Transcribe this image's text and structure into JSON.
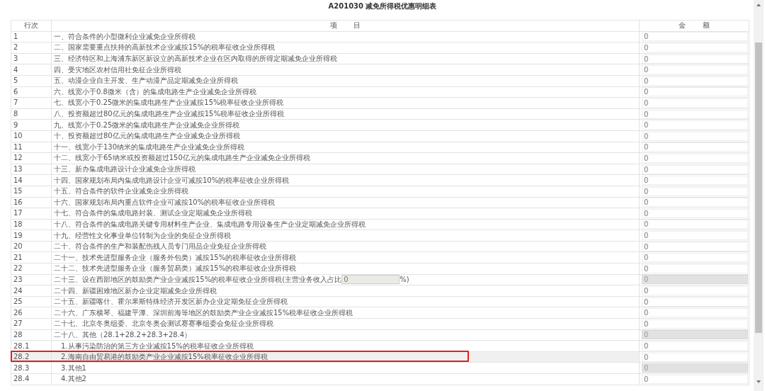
{
  "title": "A201030 减免所得税优惠明细表",
  "columns": [
    "行次",
    "项 目",
    "金 额"
  ],
  "rows": [
    {
      "line": "1",
      "item": "一、符合条件的小型微利企业减免企业所得税",
      "amount": "0",
      "disabled": false,
      "highlighted": false
    },
    {
      "line": "2",
      "item": "二、国家需要重点扶持的高新技术企业减按15%的税率征收企业所得税",
      "amount": "0",
      "disabled": false,
      "highlighted": false
    },
    {
      "line": "3",
      "item": "三、经济特区和上海浦东新区新设立的高新技术企业在区内取得的所得定期减免企业所得税",
      "amount": "0",
      "disabled": false,
      "highlighted": false
    },
    {
      "line": "4",
      "item": "四、受灾地区农村信用社免征企业所得税",
      "amount": "0",
      "disabled": false,
      "highlighted": false
    },
    {
      "line": "5",
      "item": "五、动漫企业自主开发、生产动漫产品定期减免企业所得税",
      "amount": "0",
      "disabled": false,
      "highlighted": false
    },
    {
      "line": "6",
      "item": "六、线宽小于0.8微米（含）的集成电路生产企业减免企业所得税",
      "amount": "0",
      "disabled": false,
      "highlighted": false
    },
    {
      "line": "7",
      "item": "七、线宽小于0.25微米的集成电路生产企业减按15%税率征收企业所得税",
      "amount": "0",
      "disabled": false,
      "highlighted": false
    },
    {
      "line": "8",
      "item": "八、投资额超过80亿元的集成电路生产企业减按15%税率征收企业所得税",
      "amount": "0",
      "disabled": false,
      "highlighted": false
    },
    {
      "line": "9",
      "item": "九、线宽小于0.25微米的集成电路生产企业减免企业所得税",
      "amount": "0",
      "disabled": false,
      "highlighted": false
    },
    {
      "line": "10",
      "item": "十、投资额超过80亿元的集成电路生产企业减免企业所得税",
      "amount": "0",
      "disabled": false,
      "highlighted": false
    },
    {
      "line": "11",
      "item": "十一、线宽小于130纳米的集成电路生产企业减免企业所得税",
      "amount": "0",
      "disabled": false,
      "highlighted": false
    },
    {
      "line": "12",
      "item": "十二、线宽小于65纳米或投资额超过150亿元的集成电路生产企业减免企业所得税",
      "amount": "0",
      "disabled": false,
      "highlighted": false
    },
    {
      "line": "13",
      "item": "十三、新办集成电路设计企业减免企业所得税",
      "amount": "0",
      "disabled": false,
      "highlighted": false
    },
    {
      "line": "14",
      "item": "十四、国家规划布局内集成电路设计企业可减按10%的税率征收企业所得税",
      "amount": "0",
      "disabled": false,
      "highlighted": false
    },
    {
      "line": "15",
      "item": "十五、符合条件的软件企业减免企业所得税",
      "amount": "0",
      "disabled": false,
      "highlighted": false
    },
    {
      "line": "16",
      "item": "十六、国家规划布局内重点软件企业可减按10%的税率征收企业所得税",
      "amount": "0",
      "disabled": false,
      "highlighted": false
    },
    {
      "line": "17",
      "item": "十七、符合条件的集成电路封装、测试企业定期减免企业所得税",
      "amount": "0",
      "disabled": false,
      "highlighted": false
    },
    {
      "line": "18",
      "item": "十八、符合条件的集成电路关键专用材料生产企业、集成电路专用设备生产企业定期减免企业所得税",
      "amount": "0",
      "disabled": false,
      "highlighted": false
    },
    {
      "line": "19",
      "item": "十九、经营性文化事业单位转制为企业的免征企业所得税",
      "amount": "0",
      "disabled": false,
      "highlighted": false
    },
    {
      "line": "20",
      "item": "二十、符合条件的生产和装配伤残人员专门用品企业免征企业所得税",
      "amount": "0",
      "disabled": false,
      "highlighted": false
    },
    {
      "line": "21",
      "item": "二十一、技术先进型服务企业（服务外包类）减按15%的税率征收企业所得税",
      "amount": "0",
      "disabled": false,
      "highlighted": false
    },
    {
      "line": "22",
      "item": "二十二、技术先进型服务企业（服务贸易类）减按15%的税率征收企业所得税",
      "amount": "0",
      "disabled": false,
      "highlighted": false
    },
    {
      "line": "23",
      "item": "二十三、设在西部地区的鼓励类产业企业减按15%的税率征收企业所得税(主营业务收入占比",
      "ratio_field": "0",
      "item_suffix": "%)",
      "amount": "0",
      "disabled": true,
      "highlighted": false
    },
    {
      "line": "24",
      "item": "二十四、新疆困难地区新办企业定期减免企业所得税",
      "amount": "0",
      "disabled": false,
      "highlighted": false
    },
    {
      "line": "25",
      "item": "二十五、新疆喀什、霍尔果斯特殊经济开发区新办企业定期免征企业所得税",
      "amount": "0",
      "disabled": false,
      "highlighted": false
    },
    {
      "line": "26",
      "item": "二十六、广东横琴、福建平潭、深圳前海等地区的鼓励类产业企业减按15%税率征收企业所得税",
      "amount": "0",
      "disabled": false,
      "highlighted": false
    },
    {
      "line": "27",
      "item": "二十七、北京冬奥组委、北京冬奥会测试赛赛事组委会免征企业所得税",
      "amount": "0",
      "disabled": false,
      "highlighted": false
    },
    {
      "line": "28",
      "item": "二十八、其他（28.1+28.2+28.3+28.4）",
      "amount": "0",
      "disabled": true,
      "highlighted": false,
      "children": [
        {
          "line": "28.1",
          "item": "1.从事污染防治的第三方企业减按15%的税率征收企业所得税",
          "amount": "0",
          "disabled": false,
          "highlighted": false
        },
        {
          "line": "28.2",
          "item": "2.海南自由贸易港的鼓励类产业企业减按15%税率征收企业所得税",
          "amount": "0",
          "disabled": false,
          "highlighted": true
        },
        {
          "line": "28.3",
          "item": "3.其他1",
          "amount": "0",
          "disabled": true,
          "highlighted": false
        },
        {
          "line": "28.4",
          "item": "4.其他2",
          "amount": "0",
          "disabled": false,
          "highlighted": false
        }
      ]
    }
  ]
}
